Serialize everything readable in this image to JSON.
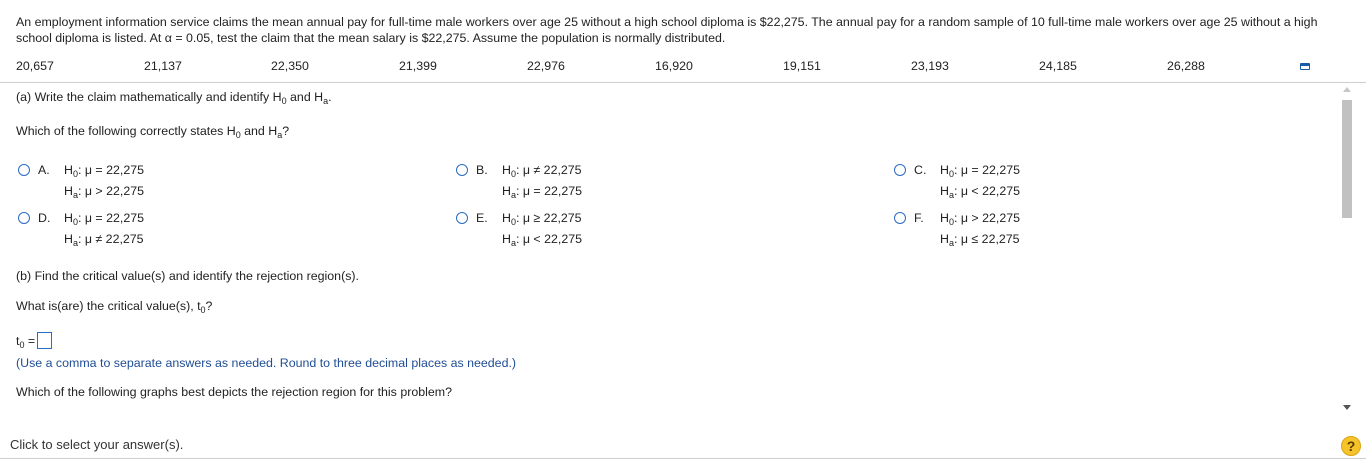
{
  "problem_text": "An employment information service claims the mean annual pay for full-time male workers over age 25 without a high school diploma is $22,275. The annual pay for a random sample of 10 full-time male workers over age 25 without a high school diploma is listed. At α = 0.05, test the claim that the mean salary is $22,275. Assume the population is normally distributed.",
  "data_values": [
    "20,657",
    "21,137",
    "22,350",
    "21,399",
    "22,976",
    "16,920",
    "19,151",
    "23,193",
    "24,185",
    "26,288"
  ],
  "part_a": {
    "prompt_pre": "(a) Write the claim mathematically and identify H",
    "prompt_sub0": "0",
    "prompt_and": " and H",
    "prompt_suba": "a",
    "prompt_end": ".",
    "question_pre": "Which of the following correctly states H",
    "question_sub0": "0",
    "question_and": " and H",
    "question_suba": "a",
    "question_end": "?"
  },
  "options": [
    {
      "letter": "A.",
      "h0": ": μ = 22,275",
      "ha": ": μ > 22,275"
    },
    {
      "letter": "B.",
      "h0": ": μ ≠ 22,275",
      "ha": ": μ = 22,275"
    },
    {
      "letter": "C.",
      "h0": ": μ = 22,275",
      "ha": ": μ < 22,275"
    },
    {
      "letter": "D.",
      "h0": ": μ = 22,275",
      "ha": ": μ ≠ 22,275"
    },
    {
      "letter": "E.",
      "h0": ": μ ≥ 22,275",
      "ha": ": μ < 22,275"
    },
    {
      "letter": "F.",
      "h0": ": μ > 22,275",
      "ha": ": μ ≤ 22,275"
    }
  ],
  "hyp_labels": {
    "h": "H",
    "sub0": "0",
    "suba": "a"
  },
  "part_b": {
    "prompt": "(b) Find the critical value(s) and identify the rejection region(s).",
    "question_pre": "What is(are) the critical value(s), t",
    "question_sub": "0",
    "question_end": "?",
    "answer_t": "t",
    "answer_sub": "0",
    "answer_eq": " =",
    "note": "(Use a comma to separate answers as needed. Round to three decimal places as needed.)",
    "graph_question": "Which of the following graphs best depicts the rejection region for this problem?"
  },
  "footer": {
    "text": "Click to select your answer(s).",
    "help_label": "?"
  }
}
